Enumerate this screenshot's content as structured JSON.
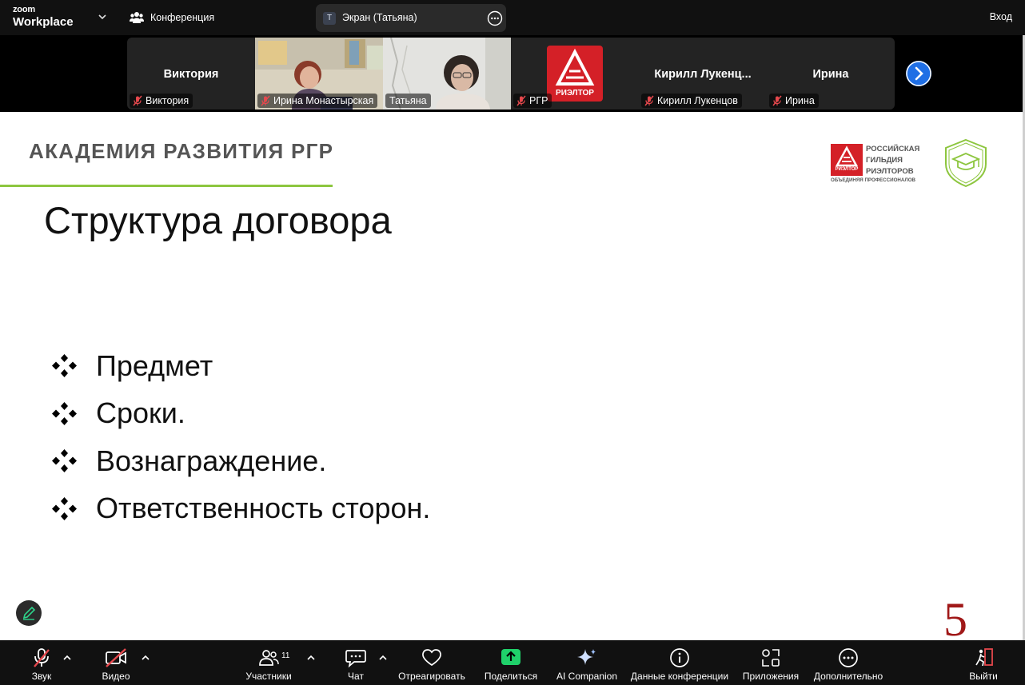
{
  "topbar": {
    "brand_small": "zoom",
    "brand_main": "Workplace",
    "conference_label": "Конференция",
    "share_initial": "T",
    "share_label": "Экран (Татьяна)",
    "login_label": "Вход"
  },
  "participants": [
    {
      "center": "Виктория",
      "tag": "Виктория",
      "muted": true
    },
    {
      "center": "",
      "tag": "Ирина Монастырская",
      "muted": true
    },
    {
      "center": "",
      "tag": "Татьяна",
      "muted": false
    },
    {
      "center": "",
      "tag": "РГР",
      "muted": true
    },
    {
      "center": "Кирилл  Лукенц...",
      "tag": "Кирилл Лукенцов",
      "muted": true
    },
    {
      "center": "Ирина",
      "tag": "Ирина",
      "muted": true
    }
  ],
  "rgr_tile_logo_text": "РИЭЛТОР",
  "slide": {
    "academy": "АКАДЕМИЯ РАЗВИТИЯ РГР",
    "title": "Структура договора",
    "bullets": [
      "Предмет",
      "Сроки.",
      "Вознаграждение.",
      "Ответственность сторон."
    ],
    "logo_line1": "РОССИЙСКАЯ",
    "logo_line2": "ГИЛЬДИЯ",
    "logo_line3": "РИЭЛТОРОВ",
    "logo_sub": "ОБЪЕДИНЯЯ ПРОФЕССИОНАЛОВ",
    "logo_box_text": "РИЭЛТОР",
    "page_number": "5"
  },
  "toolbar": {
    "audio": "Звук",
    "video": "Видео",
    "participants": "Участники",
    "participants_count": "11",
    "chat": "Чат",
    "react": "Отреагировать",
    "share": "Поделиться",
    "ai": "AI Companion",
    "info": "Данные конференции",
    "apps": "Приложения",
    "more": "Дополнительно",
    "leave": "Выйти"
  },
  "colors": {
    "accent_green": "#2ed38b",
    "share_green": "#1fd16a",
    "leave_red": "#e5484d",
    "rgr_red": "#d42027",
    "slide_line_green": "#8dc63f",
    "next_blue": "#1f6fe5"
  }
}
